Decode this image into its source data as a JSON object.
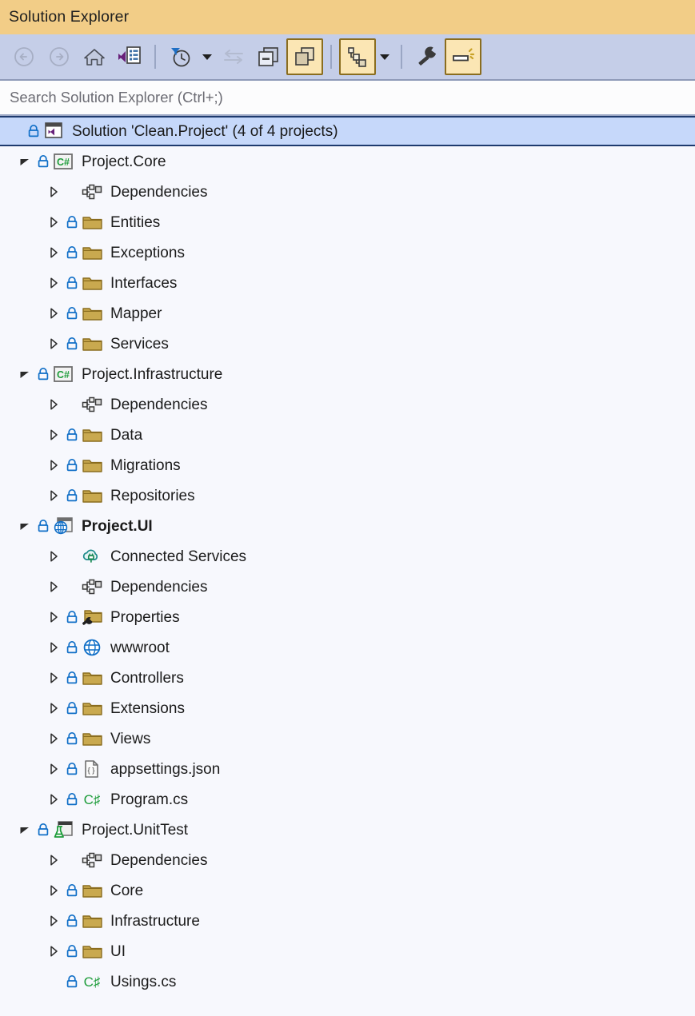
{
  "window": {
    "title": "Solution Explorer"
  },
  "toolbar": {
    "buttons": [
      {
        "name": "back-button",
        "icon": "back-arrow-icon",
        "state": "disabled"
      },
      {
        "name": "forward-button",
        "icon": "forward-arrow-icon",
        "state": "disabled"
      },
      {
        "name": "home-button",
        "icon": "home-icon",
        "state": "enabled"
      },
      {
        "name": "code-view-button",
        "icon": "vs-code-view-icon",
        "state": "enabled"
      },
      {
        "name": "pending-changes-filter",
        "icon": "funnel-clock-icon",
        "state": "enabled"
      },
      {
        "name": "sync-with-editor-button",
        "icon": "sync-arrows-icon",
        "state": "disabled"
      },
      {
        "name": "collapse-all-button",
        "icon": "collapse-all-icon",
        "state": "enabled"
      },
      {
        "name": "show-all-files-button",
        "icon": "show-all-files-icon",
        "state": "checked"
      },
      {
        "name": "view-class-diagram-button",
        "icon": "class-diagram-icon",
        "state": "checked"
      },
      {
        "name": "properties-button",
        "icon": "wrench-icon",
        "state": "enabled"
      },
      {
        "name": "preview-selected-items-button",
        "icon": "preview-icon",
        "state": "checked"
      }
    ]
  },
  "search": {
    "placeholder": "Search Solution Explorer (Ctrl+;)",
    "value": ""
  },
  "tree": {
    "nodes": [
      {
        "label": "Solution 'Clean.Project' (4 of 4 projects)",
        "depth": 0,
        "expander": "none",
        "lock": true,
        "icon": "solution-icon",
        "selected": true,
        "bold": false
      },
      {
        "label": "Project.Core",
        "depth": 0,
        "expander": "expanded",
        "lock": true,
        "icon": "csharp-project-icon",
        "selected": false,
        "bold": false
      },
      {
        "label": "Dependencies",
        "depth": 1,
        "expander": "collapsed",
        "lock": false,
        "icon": "dependencies-icon",
        "selected": false,
        "bold": false
      },
      {
        "label": "Entities",
        "depth": 1,
        "expander": "collapsed",
        "lock": true,
        "icon": "folder-icon",
        "selected": false,
        "bold": false
      },
      {
        "label": "Exceptions",
        "depth": 1,
        "expander": "collapsed",
        "lock": true,
        "icon": "folder-icon",
        "selected": false,
        "bold": false
      },
      {
        "label": "Interfaces",
        "depth": 1,
        "expander": "collapsed",
        "lock": true,
        "icon": "folder-icon",
        "selected": false,
        "bold": false
      },
      {
        "label": "Mapper",
        "depth": 1,
        "expander": "collapsed",
        "lock": true,
        "icon": "folder-icon",
        "selected": false,
        "bold": false
      },
      {
        "label": "Services",
        "depth": 1,
        "expander": "collapsed",
        "lock": true,
        "icon": "folder-icon",
        "selected": false,
        "bold": false
      },
      {
        "label": "Project.Infrastructure",
        "depth": 0,
        "expander": "expanded",
        "lock": true,
        "icon": "csharp-project-icon",
        "selected": false,
        "bold": false
      },
      {
        "label": "Dependencies",
        "depth": 1,
        "expander": "collapsed",
        "lock": false,
        "icon": "dependencies-icon",
        "selected": false,
        "bold": false
      },
      {
        "label": "Data",
        "depth": 1,
        "expander": "collapsed",
        "lock": true,
        "icon": "folder-icon",
        "selected": false,
        "bold": false
      },
      {
        "label": "Migrations",
        "depth": 1,
        "expander": "collapsed",
        "lock": true,
        "icon": "folder-icon",
        "selected": false,
        "bold": false
      },
      {
        "label": "Repositories",
        "depth": 1,
        "expander": "collapsed",
        "lock": true,
        "icon": "folder-icon",
        "selected": false,
        "bold": false
      },
      {
        "label": "Project.UI",
        "depth": 0,
        "expander": "expanded",
        "lock": true,
        "icon": "web-project-icon",
        "selected": false,
        "bold": true
      },
      {
        "label": "Connected Services",
        "depth": 1,
        "expander": "collapsed",
        "lock": false,
        "icon": "connected-services-icon",
        "selected": false,
        "bold": false
      },
      {
        "label": "Dependencies",
        "depth": 1,
        "expander": "collapsed",
        "lock": false,
        "icon": "dependencies-icon",
        "selected": false,
        "bold": false
      },
      {
        "label": "Properties",
        "depth": 1,
        "expander": "collapsed",
        "lock": true,
        "icon": "properties-folder-icon",
        "selected": false,
        "bold": false
      },
      {
        "label": "wwwroot",
        "depth": 1,
        "expander": "collapsed",
        "lock": true,
        "icon": "globe-icon",
        "selected": false,
        "bold": false
      },
      {
        "label": "Controllers",
        "depth": 1,
        "expander": "collapsed",
        "lock": true,
        "icon": "folder-icon",
        "selected": false,
        "bold": false
      },
      {
        "label": "Extensions",
        "depth": 1,
        "expander": "collapsed",
        "lock": true,
        "icon": "folder-icon",
        "selected": false,
        "bold": false
      },
      {
        "label": "Views",
        "depth": 1,
        "expander": "collapsed",
        "lock": true,
        "icon": "folder-icon",
        "selected": false,
        "bold": false
      },
      {
        "label": "appsettings.json",
        "depth": 1,
        "expander": "collapsed",
        "lock": true,
        "icon": "json-file-icon",
        "selected": false,
        "bold": false
      },
      {
        "label": "Program.cs",
        "depth": 1,
        "expander": "collapsed",
        "lock": true,
        "icon": "csharp-file-icon",
        "selected": false,
        "bold": false
      },
      {
        "label": "Project.UnitTest",
        "depth": 0,
        "expander": "expanded",
        "lock": true,
        "icon": "test-project-icon",
        "selected": false,
        "bold": false
      },
      {
        "label": "Dependencies",
        "depth": 1,
        "expander": "collapsed",
        "lock": false,
        "icon": "dependencies-icon",
        "selected": false,
        "bold": false
      },
      {
        "label": "Core",
        "depth": 1,
        "expander": "collapsed",
        "lock": true,
        "icon": "folder-icon",
        "selected": false,
        "bold": false
      },
      {
        "label": "Infrastructure",
        "depth": 1,
        "expander": "collapsed",
        "lock": true,
        "icon": "folder-icon",
        "selected": false,
        "bold": false
      },
      {
        "label": "UI",
        "depth": 1,
        "expander": "collapsed",
        "lock": true,
        "icon": "folder-icon",
        "selected": false,
        "bold": false
      },
      {
        "label": "Usings.cs",
        "depth": 1,
        "expander": "none",
        "lock": true,
        "icon": "csharp-file-icon",
        "selected": false,
        "bold": false
      }
    ]
  },
  "colors": {
    "titlebar": "#f2cd87",
    "toolbar": "#c5cee8",
    "tree_background": "#f7f8fd",
    "selection_fill": "#c6d8fa",
    "selection_border": "#1e3a6e",
    "folder": "#c09a3e",
    "lock": "#0f6ec7",
    "csharp_green": "#1d9c3a",
    "checked_button": "#fbe6b4"
  }
}
